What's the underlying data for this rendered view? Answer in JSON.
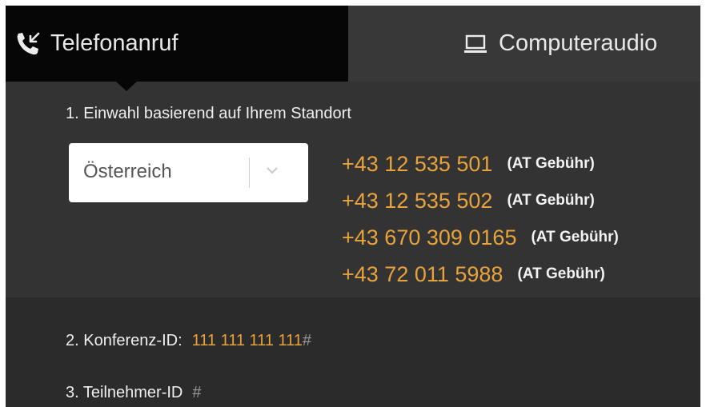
{
  "tabs": {
    "phone": {
      "label": "Telefonanruf",
      "icon": "phone-incoming-icon",
      "active": true
    },
    "computer": {
      "label": "Computeraudio",
      "icon": "monitor-icon",
      "active": false
    }
  },
  "dialin": {
    "step_label": "1. Einwahl basierend auf Ihrem Standort",
    "country_select": {
      "value": "Österreich"
    },
    "numbers": [
      {
        "number": "+43 12 535 501",
        "fee": "(AT Gebühr)"
      },
      {
        "number": "+43 12 535 502",
        "fee": "(AT Gebühr)"
      },
      {
        "number": "+43 670 309 0165",
        "fee": "(AT Gebühr)"
      },
      {
        "number": "+43 72 011 5988",
        "fee": "(AT Gebühr)"
      }
    ]
  },
  "conference": {
    "label": "2. Konferenz-ID:",
    "value": "111 111 111 111",
    "suffix": "#"
  },
  "participant": {
    "label": "3. Teilnehmer-ID",
    "suffix": "#"
  },
  "colors": {
    "accent": "#e8a33c",
    "panel_bg": "#333333",
    "active_tab_bg": "#060606",
    "tab_bg": "#383838"
  }
}
